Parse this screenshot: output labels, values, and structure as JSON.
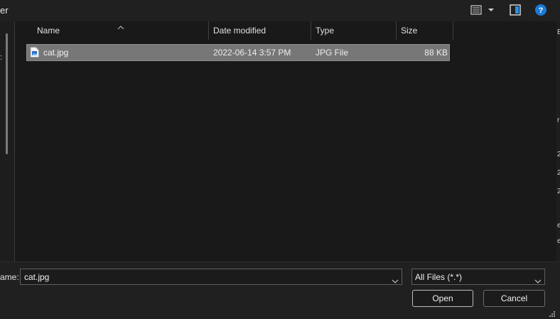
{
  "toolbar": {
    "title_fragment": "er",
    "icons": [
      "view-menu-icon",
      "chevron-down-icon",
      "preview-pane-icon",
      "help-icon"
    ],
    "help_color": "#1a7ad8"
  },
  "nav_pane": {
    "glyph": ":"
  },
  "right_strip": {
    "glyphs": [
      "E",
      "r",
      "2",
      "2",
      "2",
      "e",
      "e"
    ]
  },
  "columns": {
    "name": "Name",
    "date_modified": "Date modified",
    "type": "Type",
    "size": "Size"
  },
  "files": [
    {
      "name": "cat.jpg",
      "date_modified": "2022-06-14 3:57 PM",
      "type": "JPG File",
      "size": "88 KB",
      "selected": true,
      "icon": "image-file-icon"
    }
  ],
  "bottom": {
    "filename_label": "ame:",
    "filename_value": "cat.jpg",
    "filetype_value": "All Files (*.*)",
    "open_label": "Open",
    "cancel_label": "Cancel"
  },
  "colors": {
    "background": "#191919",
    "selection": "#777777",
    "toolbar": "#202020"
  }
}
